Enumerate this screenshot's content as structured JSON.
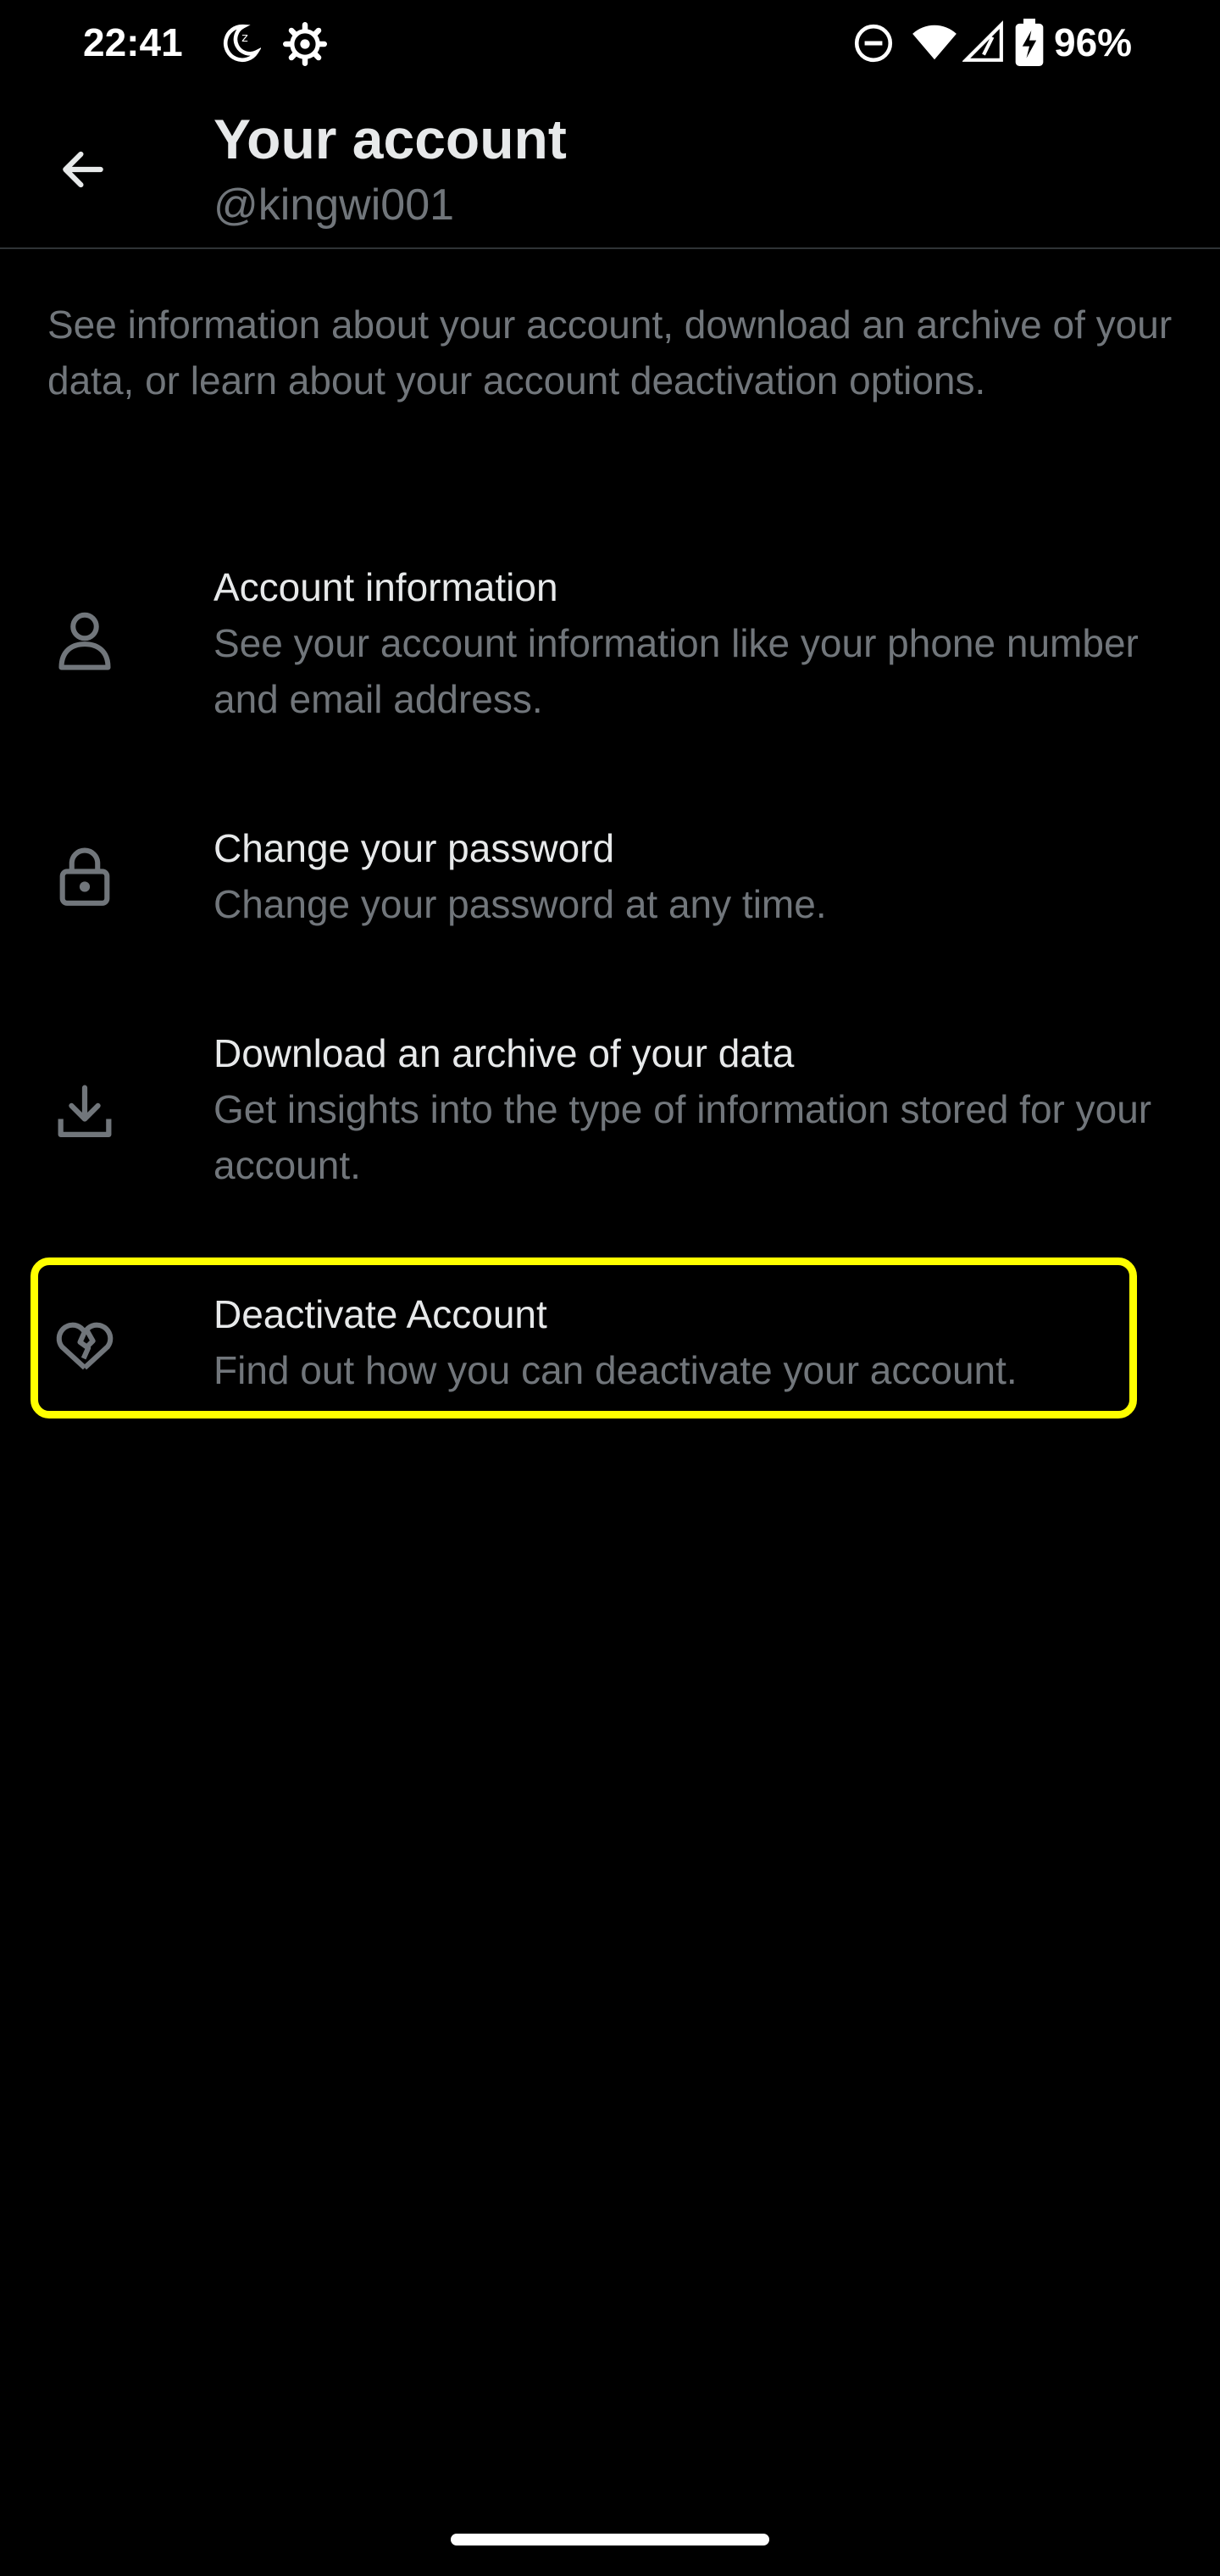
{
  "status_bar": {
    "time": "22:41",
    "icons": [
      "bedtime-moon-icon",
      "settings-gear-icon",
      "do-not-disturb-icon",
      "wifi-icon",
      "cellular-signal-icon",
      "battery-charging-icon"
    ],
    "battery": "96%"
  },
  "header": {
    "title": "Your account",
    "username": "@kingwi001",
    "back_icon": "arrow-left-icon"
  },
  "intro": "See information about your account, download an archive of your data, or learn about your account deactivation options.",
  "items": [
    {
      "title": "Account information",
      "description": "See your account information like your phone number and email address.",
      "icon": "person-icon"
    },
    {
      "title": "Change your password",
      "description": "Change your password at any time.",
      "icon": "lock-icon"
    },
    {
      "title": "Download an archive of your data",
      "description": "Get insights into the type of information stored for your account.",
      "icon": "download-icon"
    },
    {
      "title": "Deactivate Account",
      "description": "Find out how you can deactivate your account.",
      "icon": "broken-heart-icon",
      "highlighted": true
    }
  ],
  "colors": {
    "background": "#000000",
    "primary_text": "#e7e9ea",
    "secondary_text": "#71767b",
    "divider": "#2f3336",
    "highlight": "#ffff00"
  }
}
